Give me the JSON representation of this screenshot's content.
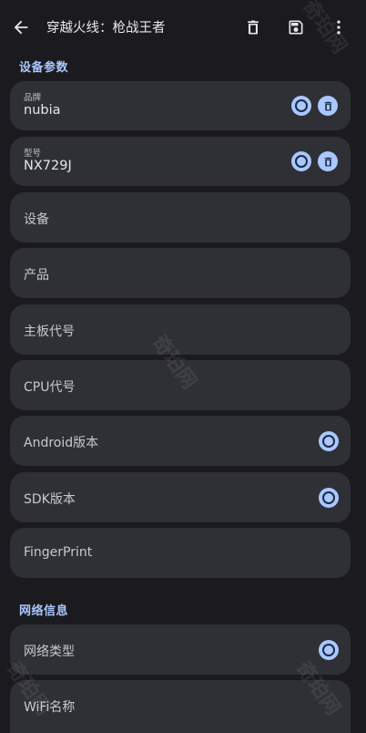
{
  "appbar": {
    "title": "穿越火线：枪战王者"
  },
  "sections": {
    "device": {
      "header": "设备参数"
    },
    "network": {
      "header": "网络信息"
    }
  },
  "device_params": {
    "brand": {
      "label": "品牌",
      "value": "nubia"
    },
    "model": {
      "label": "型号",
      "value": "NX729J"
    },
    "device": {
      "label": "设备"
    },
    "product": {
      "label": "产品"
    },
    "board": {
      "label": "主板代号"
    },
    "cpu": {
      "label": "CPU代号"
    },
    "android": {
      "label": "Android版本"
    },
    "sdk": {
      "label": "SDK版本"
    },
    "fingerprint": {
      "label": "FingerPrint"
    }
  },
  "network_info": {
    "network_type": {
      "label": "网络类型"
    },
    "wifi_name": {
      "label": "WiFi名称"
    }
  },
  "watermark": {
    "text": "奇珀网"
  },
  "colors": {
    "background": "#1b1b1f",
    "card": "#2e3035",
    "accent": "#aac7ff"
  }
}
